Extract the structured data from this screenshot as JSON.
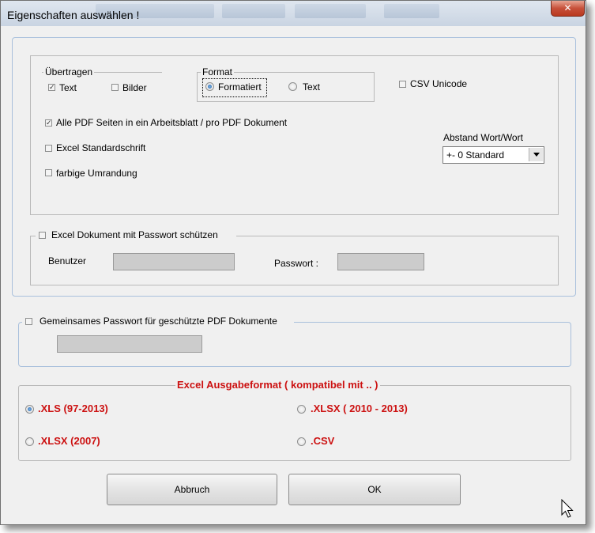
{
  "window": {
    "title": "Eigenschaften auswählen !",
    "close_glyph": "✕"
  },
  "transfer": {
    "legend": "Übertragen",
    "text_label": "Text",
    "text_checked": true,
    "images_label": "Bilder",
    "images_checked": false
  },
  "format": {
    "legend": "Format",
    "options": [
      {
        "label": "Formatiert",
        "selected": true
      },
      {
        "label": "Text",
        "selected": false
      }
    ]
  },
  "csv_unicode": {
    "label": "CSV Unicode",
    "checked": false
  },
  "options": {
    "all_pages": {
      "label": "Alle PDF Seiten in ein Arbeitsblatt / pro PDF Dokument",
      "checked": true
    },
    "standard_font": {
      "label": "Excel Standardschrift",
      "checked": false
    },
    "colored_border": {
      "label": "farbige Umrandung",
      "checked": false
    }
  },
  "spacing": {
    "label": "Abstand Wort/Wort",
    "value": "+- 0 Standard"
  },
  "protect": {
    "label": "Excel Dokument mit Passwort schützen",
    "checked": false,
    "user_label": "Benutzer",
    "user_value": "",
    "password_label": "Passwort :",
    "password_value": ""
  },
  "shared_password": {
    "label": "Gemeinsames Passwort für geschützte PDF Dokumente",
    "checked": false,
    "value": ""
  },
  "output_format": {
    "legend": "Excel Ausgabeformat  ( kompatibel mit .. )",
    "options": [
      {
        "label": ".XLS   (97-2013)",
        "selected": true
      },
      {
        "label": ".XLSX ( 2010 - 2013)",
        "selected": false
      },
      {
        "label": ".XLSX (2007)",
        "selected": false
      },
      {
        "label": ".CSV",
        "selected": false
      }
    ]
  },
  "buttons": {
    "cancel": "Abbruch",
    "ok": "OK"
  },
  "colors": {
    "accent_red": "#cc1111",
    "panel_border": "#a9c0dc",
    "close_red": "#c7503a"
  }
}
